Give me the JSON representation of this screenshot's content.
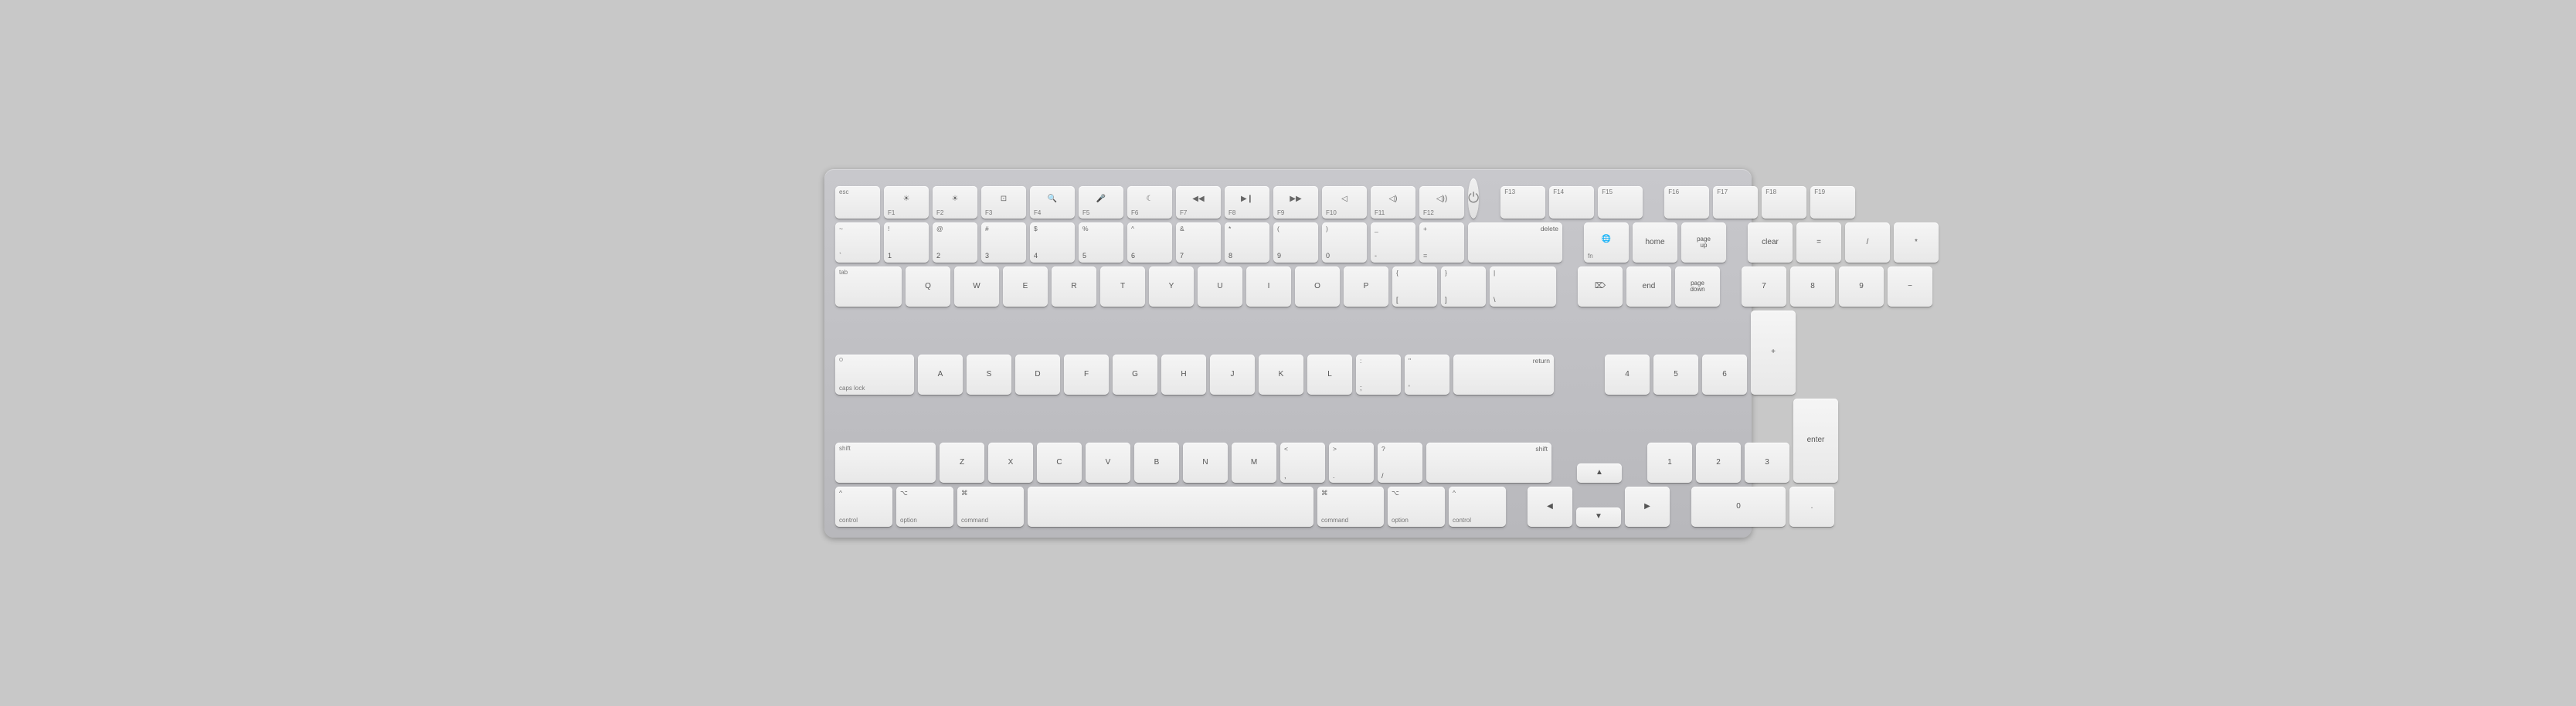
{
  "keyboard": {
    "rows": {
      "fn_row": [
        "esc",
        "F1",
        "F2",
        "F3",
        "F4",
        "F5",
        "F6",
        "F7",
        "F8",
        "F9",
        "F10",
        "F11",
        "F12",
        "power",
        "F13",
        "F14",
        "F15",
        "F16",
        "F17",
        "F18",
        "F19"
      ],
      "number_row": [
        "~`",
        "!1",
        "@2",
        "#3",
        "$4",
        "%5",
        "^6",
        "&7",
        "*8",
        "(9",
        ")0",
        "_-",
        "+=",
        "delete"
      ],
      "tab_row": [
        "tab",
        "Q",
        "W",
        "E",
        "R",
        "T",
        "Y",
        "U",
        "I",
        "O",
        "P",
        "{[",
        "}]",
        "|\\"
      ],
      "caps_row": [
        "caps lock",
        "A",
        "S",
        "D",
        "F",
        "G",
        "H",
        "J",
        "K",
        "L",
        ":;",
        "\"'",
        "return"
      ],
      "shift_row": [
        "shift",
        "Z",
        "X",
        "C",
        "V",
        "B",
        "N",
        "M",
        "<,",
        ">.",
        "?/",
        "shift"
      ],
      "bottom_row": [
        "control",
        "option",
        "command",
        "space",
        "command",
        "option",
        "control"
      ]
    }
  }
}
